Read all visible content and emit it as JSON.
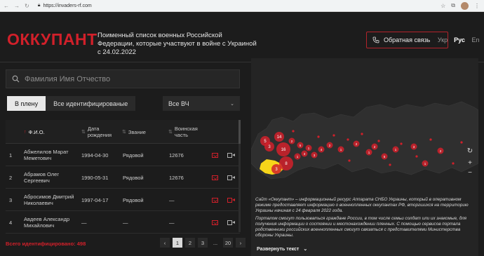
{
  "browser": {
    "url": "https://invaders-rf.com"
  },
  "header": {
    "logo": "ОККУПАНТ",
    "tagline": "Поименный список военных Российской Федерации, которые участвуют в войне с Украиной с 24.02.2022",
    "callback_label": "Обратная связь",
    "languages": [
      "Укр",
      "Рус",
      "En"
    ],
    "active_language": "Рус"
  },
  "search": {
    "placeholder": "Фамилия Имя Отчество"
  },
  "tabs": [
    {
      "label": "В плену",
      "active": true
    },
    {
      "label": "Все идентифицированые",
      "active": false
    }
  ],
  "filter": {
    "selected": "Все ВЧ"
  },
  "table": {
    "columns": [
      "Ф.И.О.",
      "Дата рождения",
      "Звание",
      "Воинская часть"
    ],
    "rows": [
      {
        "num": "1",
        "name": "Абжелилов Марат Меметович",
        "dob": "1994-04-30",
        "rank": "Рядовой",
        "unit": "12676",
        "video_active": false
      },
      {
        "num": "2",
        "name": "Абрамов Олег Сергеевич",
        "dob": "1990-05-31",
        "rank": "Рядовой",
        "unit": "12676",
        "video_active": false
      },
      {
        "num": "3",
        "name": "Абросимов Дмитрий Николаевич",
        "dob": "1997-04-17",
        "rank": "Рядовой",
        "unit": "—",
        "video_active": true
      },
      {
        "num": "4",
        "name": "Авдеев Александр Михайлович",
        "dob": "—",
        "rank": "—",
        "unit": "—",
        "video_active": false
      }
    ]
  },
  "footer": {
    "total": "Всего идентифицировано: 498",
    "pages": [
      "‹",
      "1",
      "2",
      "3",
      "...",
      "20",
      "›"
    ],
    "active_page": "1"
  },
  "map": {
    "markers": [
      {
        "label": "5",
        "size": "m"
      },
      {
        "label": "3",
        "size": "m"
      },
      {
        "label": "16",
        "size": "l"
      },
      {
        "label": "14",
        "size": "m"
      },
      {
        "label": "2",
        "size": "s"
      },
      {
        "label": "5",
        "size": "s"
      },
      {
        "label": "1",
        "size": "s"
      },
      {
        "label": "3",
        "size": "m"
      },
      {
        "label": "8",
        "size": "l"
      },
      {
        "label": "1",
        "size": "s"
      },
      {
        "label": "3",
        "size": "s"
      },
      {
        "label": "3",
        "size": "s"
      },
      {
        "label": "4",
        "size": "s"
      },
      {
        "label": "2",
        "size": "s"
      },
      {
        "label": "1",
        "size": "s"
      },
      {
        "label": "2",
        "size": "s"
      },
      {
        "label": "1",
        "size": "s"
      },
      {
        "label": "2",
        "size": "s"
      },
      {
        "label": "5",
        "size": "s"
      },
      {
        "label": "1",
        "size": "s"
      },
      {
        "label": "3",
        "size": "s"
      },
      {
        "label": "1",
        "size": "s"
      },
      {
        "label": "2",
        "size": "s"
      }
    ],
    "info_p1": "Сайт «Оккупант» – информационный ресурс Аппарата СНБО Украины, который в оперативном режиме предоставляет информацию о военнопленных оккупантах РФ, вторгшихся на территорию Украины начиная с 24 февраля 2022 года.",
    "info_p2": "Порталом смогут пользоваться граждане России, в том числе семьи солдат или их знакомые, для получения информации о состоянии и местонахождении пленных. С помощью сервисов портала родственники российских военнопленных смогут связаться с представителями Министерства обороны Украины.",
    "expand_label": "Развернуть текст"
  }
}
